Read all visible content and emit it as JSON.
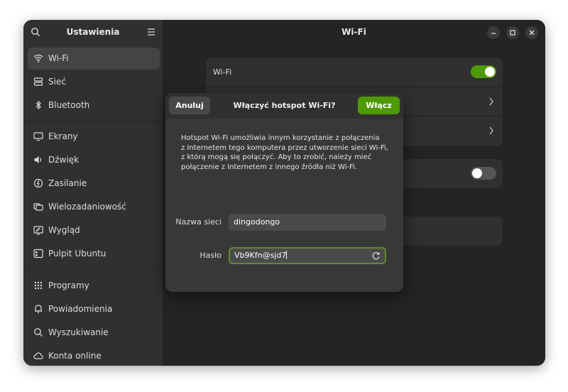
{
  "sidebar": {
    "title": "Ustawienia",
    "items": [
      {
        "label": "Wi-Fi",
        "icon": "wifi-icon",
        "active": true
      },
      {
        "label": "Sieć",
        "icon": "network-icon"
      },
      {
        "label": "Bluetooth",
        "icon": "bluetooth-icon"
      },
      {
        "label": "Ekrany",
        "icon": "display-icon"
      },
      {
        "label": "Dźwięk",
        "icon": "speaker-icon"
      },
      {
        "label": "Zasilanie",
        "icon": "power-icon"
      },
      {
        "label": "Wielozadaniowość",
        "icon": "multitasking-icon"
      },
      {
        "label": "Wygląd",
        "icon": "appearance-icon"
      },
      {
        "label": "Pulpit Ubuntu",
        "icon": "ubuntu-desktop-icon"
      },
      {
        "label": "Programy",
        "icon": "apps-grid-icon"
      },
      {
        "label": "Powiadomienia",
        "icon": "bell-icon"
      },
      {
        "label": "Wyszukiwanie",
        "icon": "search-icon"
      },
      {
        "label": "Konta online",
        "icon": "cloud-icon"
      }
    ]
  },
  "main": {
    "title": "Wi-Fi",
    "wifi_row_label": "Wi-Fi",
    "wifi_enabled": true
  },
  "dialog": {
    "cancel_label": "Anuluj",
    "title": "Włączyć hotspot Wi-Fi?",
    "confirm_label": "Włącz",
    "body_lines": [
      "Hotspot Wi-Fi umożliwia innym korzystanie z połączenia",
      "z Internetem tego komputera przez utworzenie sieci Wi-Fi,",
      "z którą mogą się połączyć. Aby to zrobić, należy mieć",
      "połączenie z Internetem z innego źródła niż Wi-Fi."
    ],
    "network_name_label": "Nazwa sieci",
    "network_name_value": "dingodongo",
    "password_label": "Hasło",
    "password_value": "Vb9Kfn@sjd7"
  },
  "colors": {
    "accent": "#4e9a06",
    "focus_border": "#5f8a2c",
    "window_bg": "#242424",
    "sidebar_bg": "#303030"
  }
}
